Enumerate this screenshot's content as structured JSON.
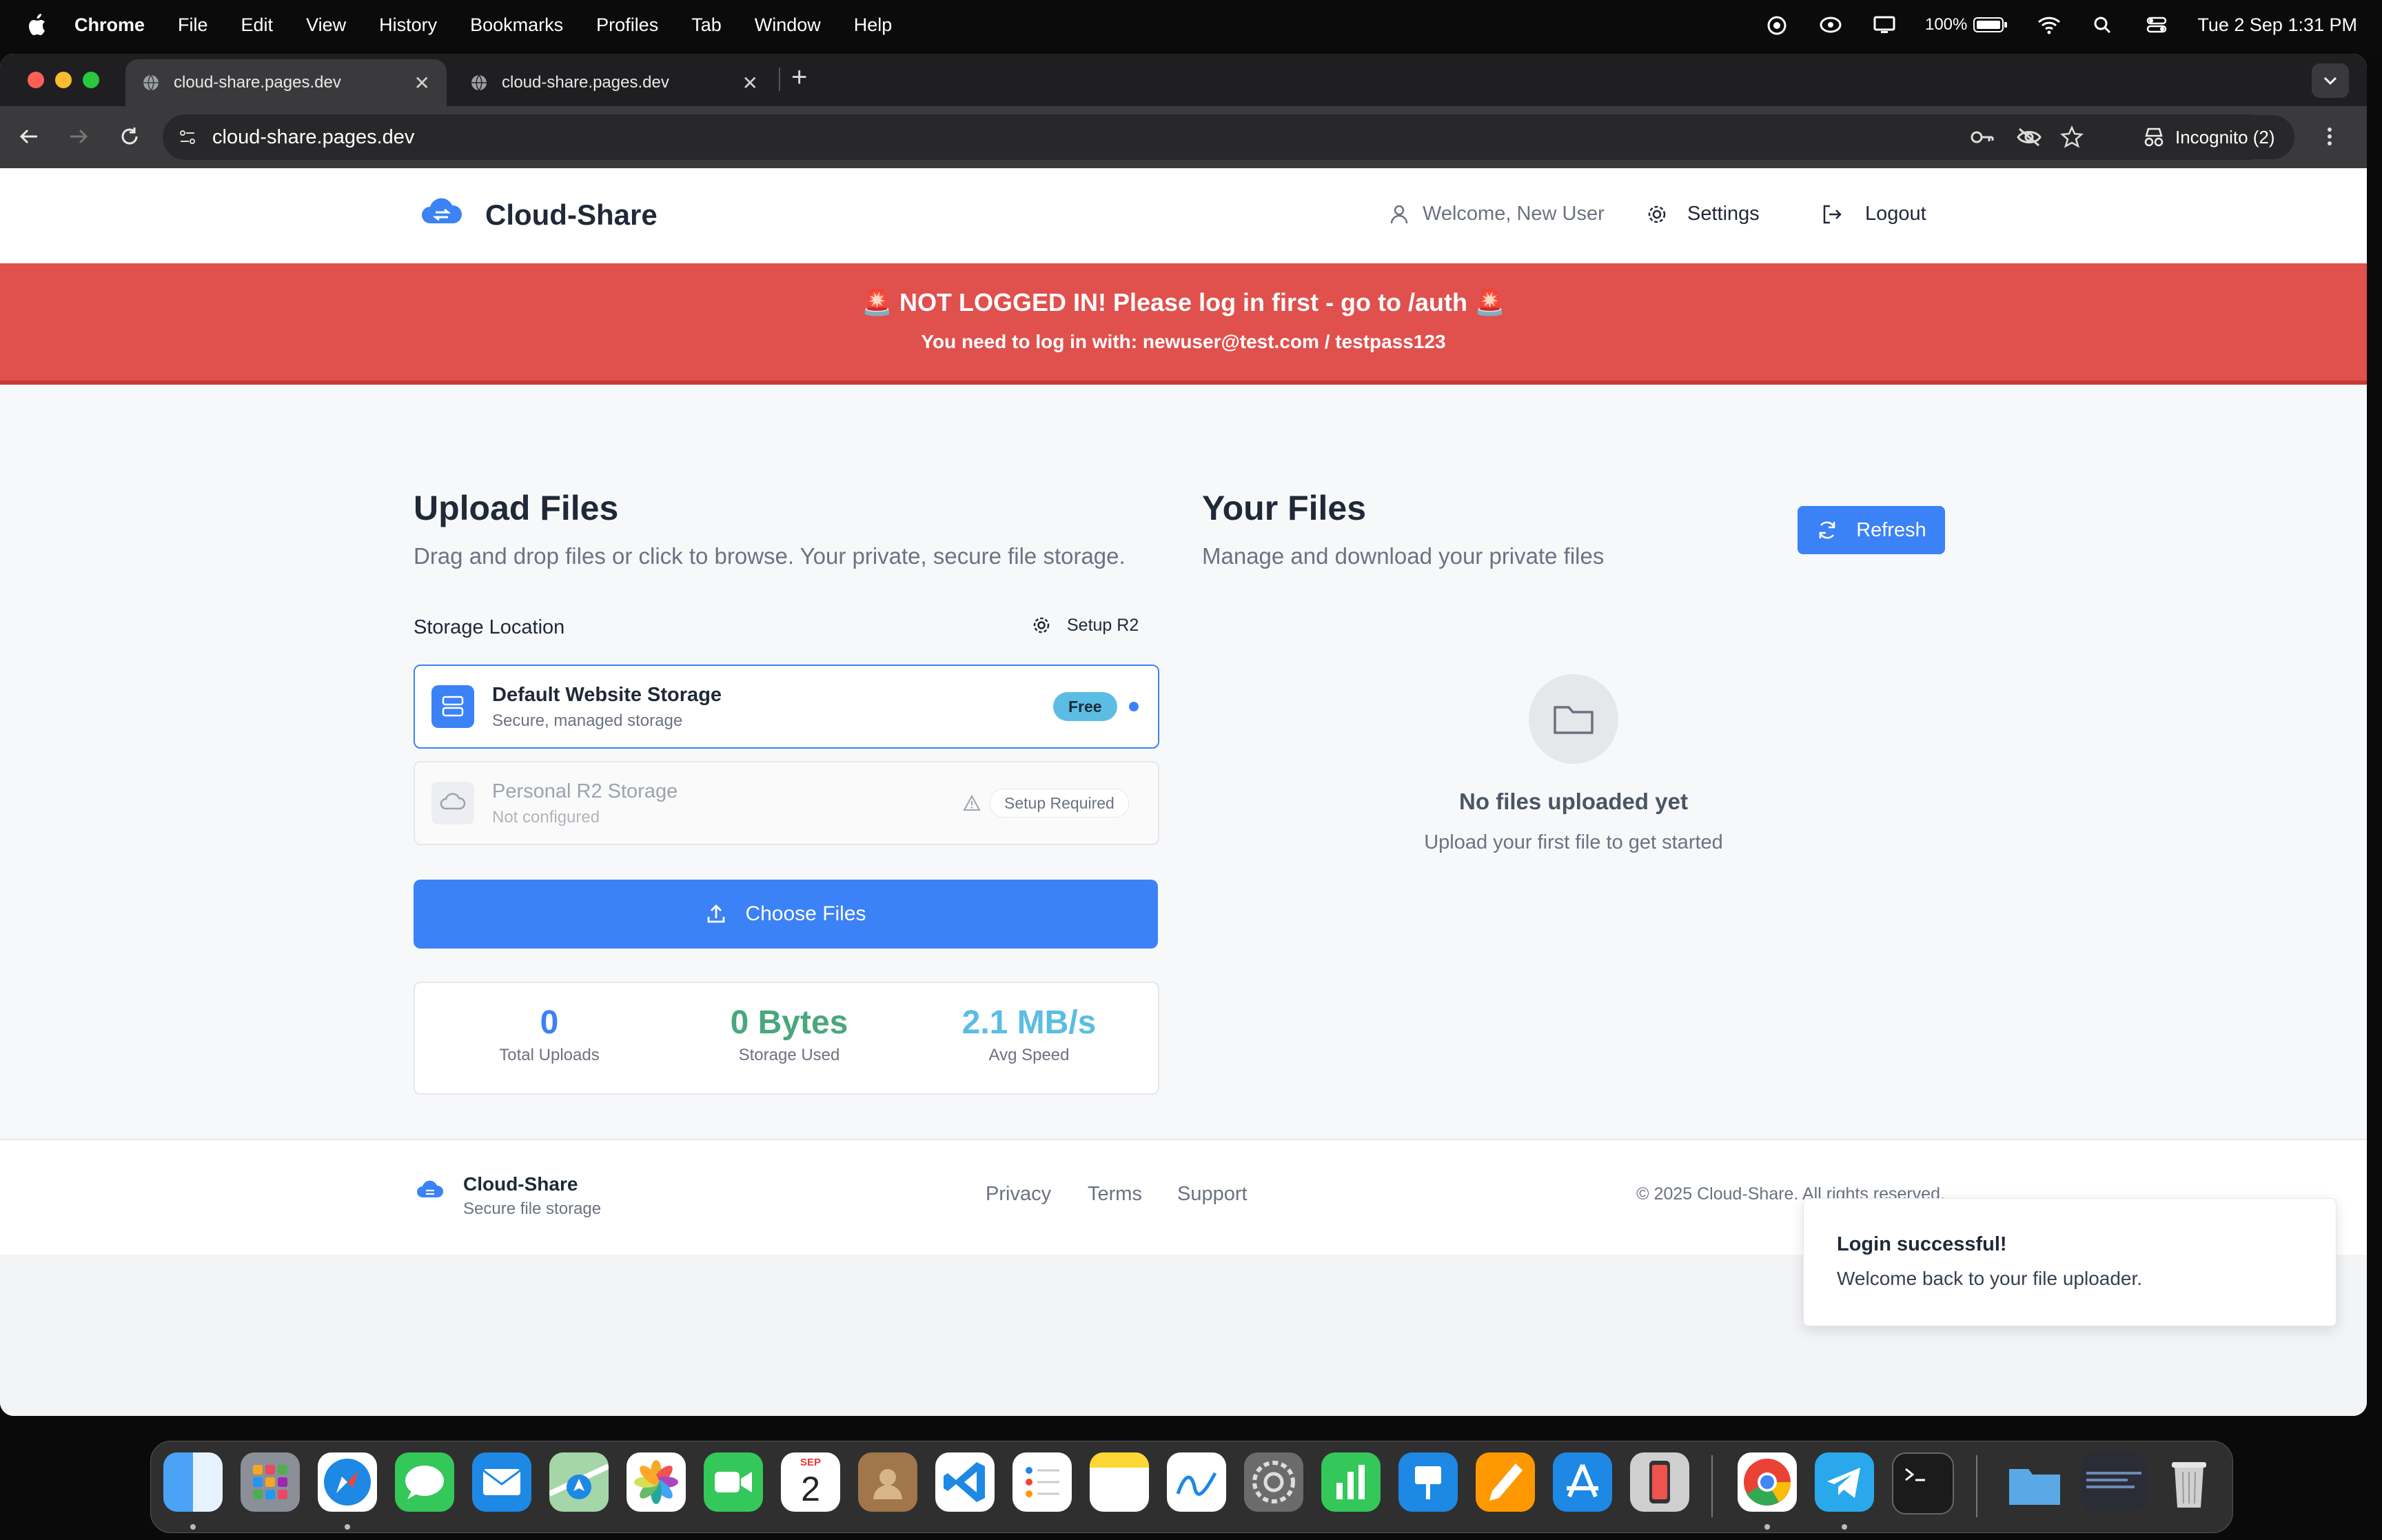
{
  "menubar": {
    "app": "Chrome",
    "items": [
      "File",
      "Edit",
      "View",
      "History",
      "Bookmarks",
      "Profiles",
      "Tab",
      "Window",
      "Help"
    ],
    "battery": "100%",
    "datetime": "Tue 2 Sep  1:31 PM"
  },
  "browser": {
    "tabs": [
      {
        "title": "cloud-share.pages.dev",
        "active": true
      },
      {
        "title": "cloud-share.pages.dev",
        "active": false
      }
    ],
    "url": "cloud-share.pages.dev",
    "incognito_label": "Incognito (2)"
  },
  "header": {
    "brand": "Cloud-Share",
    "welcome": "Welcome, New User",
    "settings": "Settings",
    "logout": "Logout"
  },
  "alert": {
    "line1": "🚨 NOT LOGGED IN! Please log in first - go to /auth 🚨",
    "line2": "You need to log in with: newuser@test.com / testpass123"
  },
  "upload": {
    "title": "Upload Files",
    "subtitle": "Drag and drop files or click to browse. Your private, secure file storage.",
    "storage_label": "Storage Location",
    "setup_r2": "Setup R2",
    "default_storage": {
      "name": "Default Website Storage",
      "desc": "Secure, managed storage",
      "badge": "Free"
    },
    "personal_storage": {
      "name": "Personal R2 Storage",
      "desc": "Not configured",
      "badge": "Setup Required"
    },
    "choose_files": "Choose Files",
    "stats": [
      {
        "value": "0",
        "label": "Total Uploads",
        "color": "#3b82f6"
      },
      {
        "value": "0 Bytes",
        "label": "Storage Used",
        "color": "#4aa77d"
      },
      {
        "value": "2.1 MB/s",
        "label": "Avg Speed",
        "color": "#5bbde4"
      }
    ]
  },
  "files": {
    "title": "Your Files",
    "subtitle": "Manage and download your private files",
    "refresh": "Refresh",
    "empty_title": "No files uploaded yet",
    "empty_sub": "Upload your first file to get started"
  },
  "footer": {
    "brand": "Cloud-Share",
    "tagline": "Secure file storage",
    "links": [
      "Privacy",
      "Terms",
      "Support"
    ],
    "copyright": "© 2025 Cloud-Share. All rights reserved."
  },
  "toast": {
    "title": "Login successful!",
    "message": "Welcome back to your file uploader."
  },
  "dock": {
    "calendar_month": "SEP",
    "calendar_day": "2"
  },
  "colors": {
    "primary": "#3b82f6",
    "alert": "#e0504d"
  }
}
